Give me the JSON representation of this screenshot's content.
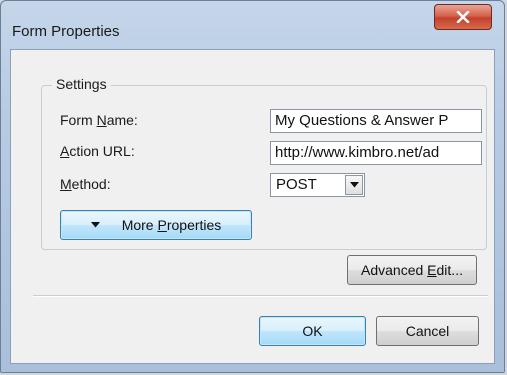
{
  "window": {
    "title": "Form Properties"
  },
  "settings": {
    "legend": "Settings",
    "form_name_label_pre": "Form ",
    "form_name_label_ul": "N",
    "form_name_label_post": "ame:",
    "form_name_value": "My Questions & Answer P",
    "action_url_label_ul": "A",
    "action_url_label_post": "ction URL:",
    "action_url_value": "http://www.kimbro.net/ad",
    "method_label_ul": "M",
    "method_label_post": "ethod:",
    "method_value": "POST",
    "more_properties_pre": "More ",
    "more_properties_ul": "P",
    "more_properties_post": "roperties"
  },
  "buttons": {
    "advanced_edit_pre": "Advanced ",
    "advanced_edit_ul": "E",
    "advanced_edit_post": "dit...",
    "ok": "OK",
    "cancel": "Cancel"
  },
  "icons": {
    "close": "close-icon",
    "dropdown": "chevron-down-icon",
    "expand": "triangle-down-icon"
  },
  "colors": {
    "close_button": "#c8452f",
    "focus_button": "#3c7fb1",
    "title_bar": "#b7cbe3"
  }
}
